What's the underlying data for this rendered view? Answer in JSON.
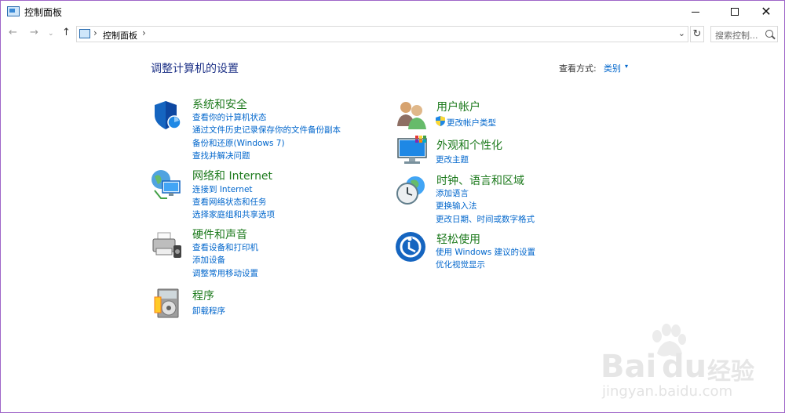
{
  "window": {
    "title": "控制面板",
    "minimize_label": "–",
    "maximize_label": "□",
    "close_label": "✕"
  },
  "nav": {
    "back": "←",
    "forward": "→",
    "recent": "⌄",
    "up": "↑",
    "address_separator": "›",
    "address_text": "控制面板",
    "address_dropdown": "⌄",
    "refresh": "↻",
    "search_placeholder": "搜索控制..."
  },
  "main": {
    "title": "调整计算机的设置",
    "view_by_label": "查看方式:",
    "view_by_value": "类别",
    "view_by_caret": "▾"
  },
  "categories": {
    "system": {
      "title": "系统和安全",
      "links": [
        "查看你的计算机状态",
        "通过文件历史记录保存你的文件备份副本",
        "备份和还原(Windows 7)",
        "查找并解决问题"
      ]
    },
    "network": {
      "title": "网络和 Internet",
      "links": [
        "连接到 Internet",
        "查看网络状态和任务",
        "选择家庭组和共享选项"
      ]
    },
    "hardware": {
      "title": "硬件和声音",
      "links": [
        "查看设备和打印机",
        "添加设备",
        "调整常用移动设置"
      ]
    },
    "programs": {
      "title": "程序",
      "links": [
        "卸载程序"
      ]
    },
    "user": {
      "title": "用户帐户",
      "links": [
        "更改帐户类型"
      ]
    },
    "appearance": {
      "title": "外观和个性化",
      "links": [
        "更改主题"
      ]
    },
    "clock": {
      "title": "时钟、语言和区域",
      "links": [
        "添加语言",
        "更换输入法",
        "更改日期、时间或数字格式"
      ]
    },
    "ease": {
      "title": "轻松使用",
      "links": [
        "使用 Windows 建议的设置",
        "优化视觉显示"
      ]
    }
  },
  "watermark": {
    "brand": "Bai",
    "brand2": "du",
    "cn": "经验",
    "url": "jingyan.baidu.com"
  },
  "colors": {
    "title_blue": "#1e3287",
    "category_green": "#1d7a1d",
    "link_blue": "#0066cc",
    "window_border": "#9f66c9"
  }
}
